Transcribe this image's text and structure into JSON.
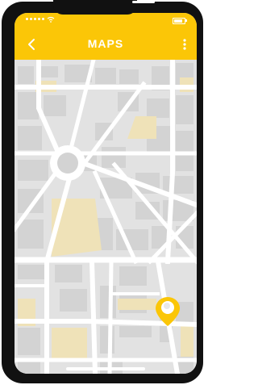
{
  "header": {
    "title": "MAPS",
    "back_icon": "chevron-left-icon",
    "menu_icon": "more-vertical-icon"
  },
  "status_bar": {
    "signal_icon": "signal-dots-icon",
    "wifi_icon": "wifi-icon",
    "battery_icon": "battery-icon"
  },
  "map": {
    "marker_icon": "location-pin-icon"
  },
  "colors": {
    "accent": "#fbc607",
    "road": "#ffffff",
    "block": "#d3d3d3",
    "land": "#e2e2e2",
    "park": "#efe2b8",
    "frame": "#111111"
  }
}
